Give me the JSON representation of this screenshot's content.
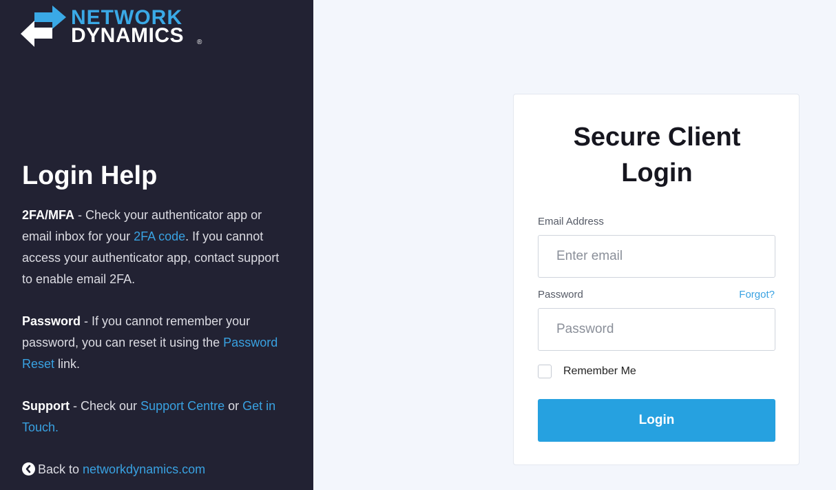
{
  "brand": {
    "line1": "NETWORK",
    "line2": "DYNAMICS",
    "registered": "®",
    "colors": {
      "accent": "#3aa9e6",
      "panel": "#222233",
      "button": "#26a1e0",
      "link": "#39a2e2"
    }
  },
  "help": {
    "title": "Login Help",
    "mfa": {
      "term": "2FA/MFA",
      "text_before": " - Check your authenticator app or email inbox for your ",
      "link": "2FA code",
      "text_after": ". If you cannot access your authenticator app, contact support to enable email 2FA."
    },
    "password": {
      "term": "Password",
      "text_before": " - If you cannot remember your password, you can reset it using the ",
      "link": "Password Reset",
      "text_after": " link."
    },
    "support": {
      "term": "Support",
      "text_before": " - Check our ",
      "link1": "Support Centre",
      "text_middle": " or ",
      "link2": "Get in Touch."
    },
    "back": {
      "icon": "chevron-left-circle-icon",
      "text": "Back to ",
      "link": "networkdynamics.com"
    }
  },
  "login": {
    "title_line1": "Secure Client",
    "title_line2": "Login",
    "email_label": "Email Address",
    "email_placeholder": "Enter email",
    "email_value": "",
    "password_label": "Password",
    "forgot_link": "Forgot?",
    "password_placeholder": "Password",
    "password_value": "",
    "remember_label": "Remember Me",
    "remember_checked": false,
    "submit_label": "Login"
  }
}
